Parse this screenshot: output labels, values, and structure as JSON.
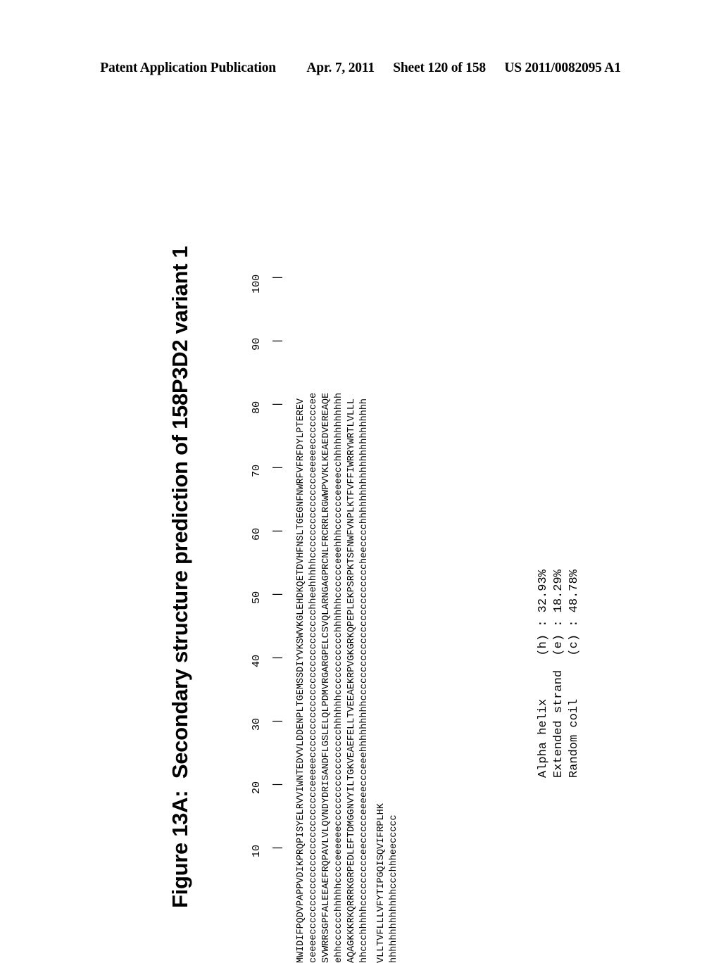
{
  "header": {
    "publication": "Patent Application Publication",
    "date": "Apr. 7, 2011",
    "sheet": "Sheet 120 of 158",
    "patent_number": "US 2011/0082095 A1"
  },
  "figure": {
    "title": "Figure 13A:  Secondary structure prediction of 158P3D2 variant 1",
    "ruler": {
      "numbers": "        10        20        30        40        50        60        70        80        90       100",
      "ticks": "         |         |         |         |         |         |         |         |         |         |"
    },
    "lines": [
      "MWIDIFPQDVPAPPVDIKPRQPISYELRVVIWNTEDVVLDDENPLTGEMSSDIYVKSWVKGLEHDKQETDVHFNSLTGEGNFNWRFVFRFDYLPTEREV",
      "ceeeecccccccccccccccccccccccccceeeeecccccccccccccccccccccccccchheehhhhhccccccccccccccceeeeecccccccee",
      "SVWRRSGPFALEEAEFRQPAVLVLQVNDYDRISANDFLGSLELQLPDMVRGARGPELCSVQLARNGAGPRCNLFRCRRLRGWWPVVKLKEAEDVEREAQE",
      "ehhcccccchhhhhcccceeeeeeccccccccccccccccchhhhhhccccccccccchhhhhhcccccceeehhhcccccceeeecchhhhhhhhhhhh",
      "AQAGKKKRKQRRRKGRPEDLEFTDMGGNVYILTGKVEAEFELLTVEEAEKRPVGKGRKQPEPLEKPSRPKTSFNWFVNPLKTFVFFIWRRYWRTLVLLL",
      "hhccchhhhhccccccccceeccccceeeeeccceeehhhhhhhhhccccccccccccccccccccccccheecccchhhhhhhhhhhhhhhhhhhhhh",
      "VLLTVFLLLVFYTIPGQISQVIFRPLHK",
      "hhhhhhhhhhhhhccchhheeccccc"
    ],
    "stats": [
      "Alpha helix      (h) : 32.93%",
      "Extended strand  (e) : 18.29%",
      "Random coil      (c) : 48.78%"
    ]
  }
}
